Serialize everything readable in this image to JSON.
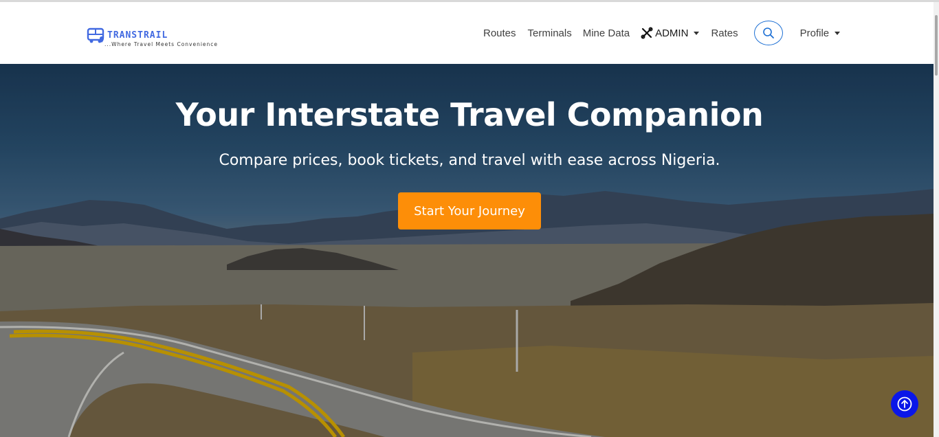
{
  "brand": {
    "name": "TRANSTRAIL",
    "tagline": "...Where Travel Meets Convenience",
    "logo_icon": "bus-icon",
    "accent": "#4169e1"
  },
  "nav": {
    "routes": "Routes",
    "terminals": "Terminals",
    "mine_data": "Mine Data",
    "admin": "ADMIN",
    "admin_icon": "tools-icon",
    "rates": "Rates",
    "search_icon": "search-icon",
    "profile": "Profile"
  },
  "hero": {
    "title": "Your Interstate Travel Companion",
    "subtitle": "Compare prices, book tickets, and travel with ease across Nigeria.",
    "cta_label": "Start Your Journey",
    "cta_color": "#fd8e08"
  },
  "scroll_top": {
    "icon": "arrow-up-circle-icon",
    "color": "#0a16e8"
  }
}
